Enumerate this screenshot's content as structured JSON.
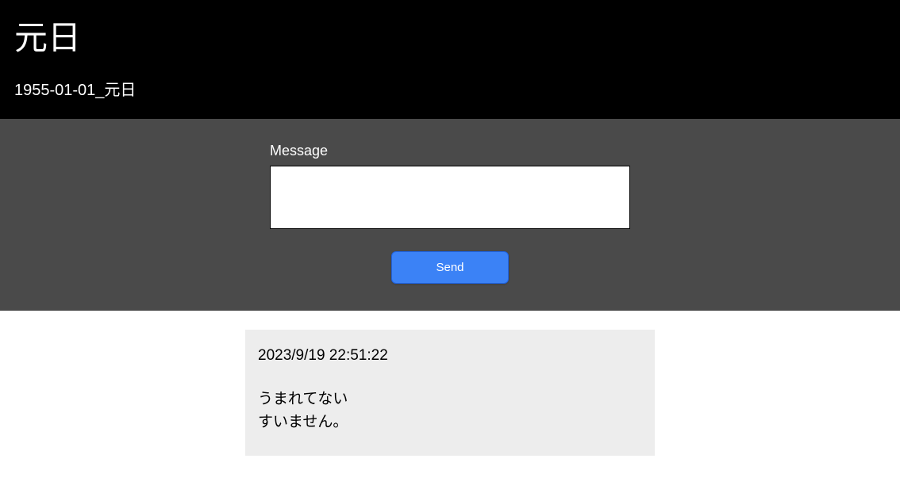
{
  "header": {
    "title": "元日",
    "subtitle": "1955-01-01_元日"
  },
  "form": {
    "label": "Message",
    "textarea_value": "",
    "textarea_placeholder": "",
    "send_label": "Send"
  },
  "comments": [
    {
      "timestamp": "2023/9/19 22:51:22",
      "body": "うまれてない\nすいません。"
    }
  ]
}
